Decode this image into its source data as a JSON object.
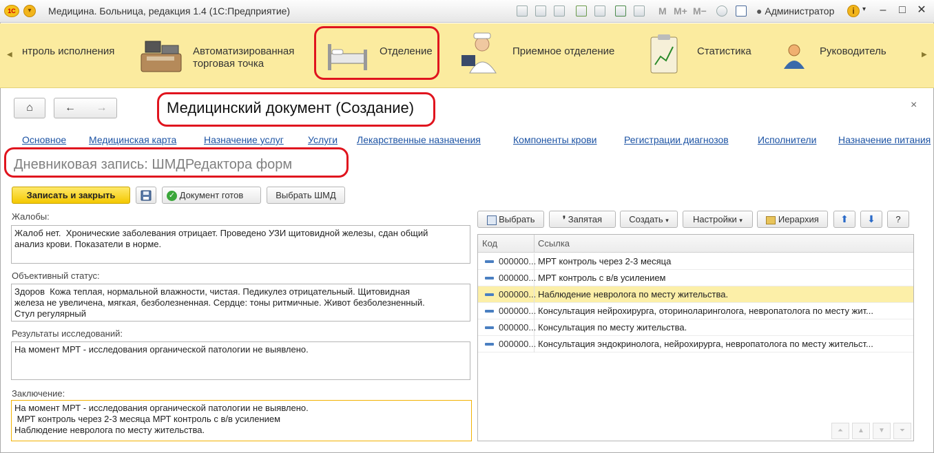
{
  "window": {
    "title": "Медицина. Больница, редакция 1.4 (1С:Предприятие)",
    "logo": "1С",
    "user": "Администратор",
    "tb_m": "M",
    "tb_mplus": "M+",
    "tb_mminus": "M−",
    "min": "–",
    "max": "□",
    "close": "✕"
  },
  "sections": {
    "items": [
      {
        "label": "нтроль исполнения",
        "icon": "control-icon"
      },
      {
        "label": "Автоматизированная\nторговая точка",
        "icon": "cash-register-icon"
      },
      {
        "label": "Отделение",
        "icon": "hospital-bed-icon"
      },
      {
        "label": "Приемное отделение",
        "icon": "doctor-icon"
      },
      {
        "label": "Статистика",
        "icon": "chart-clipboard-icon"
      },
      {
        "label": "Руководитель",
        "icon": "manager-icon"
      }
    ]
  },
  "form": {
    "title": "Медицинский документ (Создание)",
    "close": "×",
    "tabs": [
      "Основное",
      "Медицинская карта",
      "Назначение услуг",
      "Услуги",
      "Лекарственные назначения",
      "Компоненты крови",
      "Регистрации диагнозов",
      "Исполнители",
      "Назначение питания"
    ],
    "subtitle": "Дневниковая запись: ШМДРедактора форм",
    "buttons": {
      "save_close": "Записать и закрыть",
      "doc_ready": "Документ готов",
      "select_shmd": "Выбрать ШМД"
    }
  },
  "fields": {
    "complaints_label": "Жалобы:",
    "complaints_value": "Жалоб нет.  Хронические заболевания отрицает. Проведено УЗИ щитовидной железы, сдан общий\nанализ крови. Показатели в норме.",
    "objective_label": "Объективный статус:",
    "objective_value": "Здоров  Кожа теплая, нормальной влажности, чистая. Педикулез отрицательный. Щитовидная\nжелеза не увеличена, мягкая, безболезненная. Сердце: тоны ритмичные. Живот безболезненный.\nСтул регулярный",
    "results_label": "Результаты исследований:",
    "results_value": "На момент МРТ - исследования органической патологии не выявлено.",
    "conclusion_label": "Заключение:",
    "conclusion_value": "На момент МРТ - исследования органической патологии не выявлено.\n МРТ контроль через 2-3 месяца МРТ контроль с в/в усилением\nНаблюдение невролога по месту жительства."
  },
  "panel": {
    "buttons": {
      "select": "Выбрать",
      "comma": "Запятая",
      "create": "Создать",
      "settings": "Настройки",
      "hierarchy": "Иерархия",
      "help": "?"
    },
    "columns": {
      "code": "Код",
      "ref": "Ссылка"
    },
    "rows": [
      {
        "code": "000000...",
        "ref": "МРТ контроль через 2-3 месяца"
      },
      {
        "code": "000000...",
        "ref": "МРТ контроль с в/в усилением"
      },
      {
        "code": "000000...",
        "ref": "Наблюдение невролога по месту жительства."
      },
      {
        "code": "000000...",
        "ref": "Консультация нейрохирурга, оториноларинголога, невропатолога по месту жит..."
      },
      {
        "code": "000000...",
        "ref": "Консультация по месту жительства."
      },
      {
        "code": "000000...",
        "ref": "Консультация эндокринолога, нейрохирурга, невропатолога по месту жительст..."
      }
    ],
    "selected_row": 2
  },
  "colors": {
    "sections_bg": "#fbeb9f",
    "highlight": "#e0141e",
    "link": "#1c53a4",
    "primary_button": "#f4c800",
    "selected_row": "#fcefa8"
  }
}
